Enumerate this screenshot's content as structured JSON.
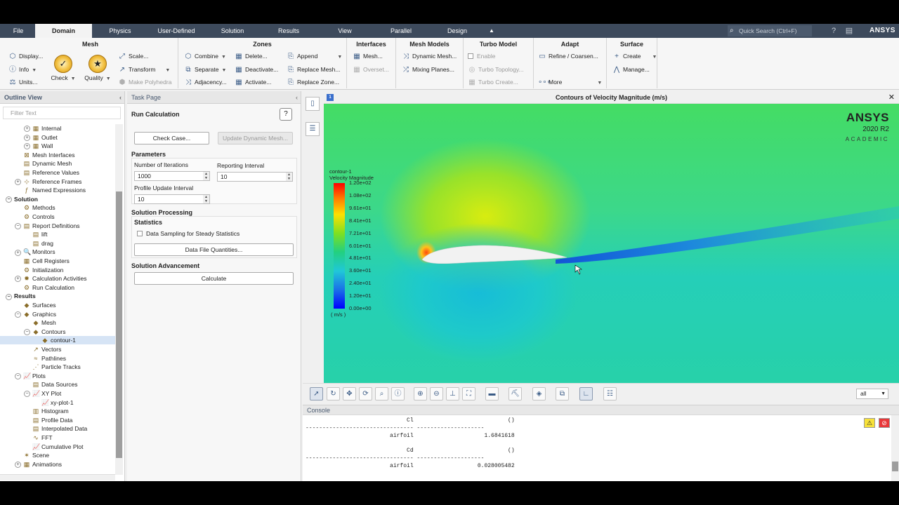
{
  "menubar": {
    "items": [
      "File",
      "Domain",
      "Physics",
      "User-Defined",
      "Solution",
      "Results",
      "View",
      "Parallel",
      "Design"
    ],
    "active": "Domain",
    "quick_search_placeholder": "Quick Search (Ctrl+F)",
    "brand": "ANSYS"
  },
  "ribbon": {
    "mesh": {
      "title": "Mesh",
      "display": "Display...",
      "info": "Info",
      "units": "Units...",
      "check": "Check",
      "quality": "Quality",
      "scale": "Scale...",
      "transform": "Transform",
      "make_polyhedra": "Make Polyhedra"
    },
    "zones": {
      "title": "Zones",
      "combine": "Combine",
      "separate": "Separate",
      "adjacency": "Adjacency...",
      "delete": "Delete...",
      "deactivate": "Deactivate...",
      "activate": "Activate...",
      "append": "Append",
      "replace_mesh": "Replace Mesh...",
      "replace_zone": "Replace Zone..."
    },
    "interfaces": {
      "title": "Interfaces",
      "mesh": "Mesh...",
      "overset": "Overset..."
    },
    "mesh_models": {
      "title": "Mesh Models",
      "dynamic_mesh": "Dynamic Mesh...",
      "mixing_planes": "Mixing Planes..."
    },
    "turbo_model": {
      "title": "Turbo Model",
      "enable": "Enable",
      "turbo_topology": "Turbo Topology...",
      "turbo_create": "Turbo Create..."
    },
    "adapt": {
      "title": "Adapt",
      "refine_coarsen": "Refine / Coarsen...",
      "more": "More"
    },
    "surface": {
      "title": "Surface",
      "create": "Create",
      "manage": "Manage..."
    }
  },
  "outline": {
    "header": "Outline View",
    "filter_placeholder": "Filter Text",
    "rows": [
      {
        "label": "Internal",
        "indent": 2,
        "exp": "+",
        "icon": "▦"
      },
      {
        "label": "Outlet",
        "indent": 2,
        "exp": "+",
        "icon": "▦"
      },
      {
        "label": "Wall",
        "indent": 2,
        "exp": "+",
        "icon": "▦"
      },
      {
        "label": "Mesh Interfaces",
        "indent": 1,
        "exp": "",
        "icon": "⊠"
      },
      {
        "label": "Dynamic Mesh",
        "indent": 1,
        "exp": "",
        "icon": "▤"
      },
      {
        "label": "Reference Values",
        "indent": 1,
        "exp": "",
        "icon": "▤"
      },
      {
        "label": "Reference Frames",
        "indent": 1,
        "exp": "+",
        "icon": "⊹"
      },
      {
        "label": "Named Expressions",
        "indent": 1,
        "exp": "",
        "icon": "ƒ"
      },
      {
        "label": "Solution",
        "indent": 0,
        "exp": "−",
        "icon": "",
        "section": true
      },
      {
        "label": "Methods",
        "indent": 1,
        "exp": "",
        "icon": "⚙"
      },
      {
        "label": "Controls",
        "indent": 1,
        "exp": "",
        "icon": "⚙"
      },
      {
        "label": "Report Definitions",
        "indent": 1,
        "exp": "−",
        "icon": "▤"
      },
      {
        "label": "lift",
        "indent": 2,
        "exp": "",
        "icon": "▤"
      },
      {
        "label": "drag",
        "indent": 2,
        "exp": "",
        "icon": "▤"
      },
      {
        "label": "Monitors",
        "indent": 1,
        "exp": "+",
        "icon": "🔍"
      },
      {
        "label": "Cell Registers",
        "indent": 1,
        "exp": "",
        "icon": "▦"
      },
      {
        "label": "Initialization",
        "indent": 1,
        "exp": "",
        "icon": "⚙"
      },
      {
        "label": "Calculation Activities",
        "indent": 1,
        "exp": "+",
        "icon": "✹"
      },
      {
        "label": "Run Calculation",
        "indent": 1,
        "exp": "",
        "icon": "⚙"
      },
      {
        "label": "Results",
        "indent": 0,
        "exp": "−",
        "icon": "",
        "section": true
      },
      {
        "label": "Surfaces",
        "indent": 1,
        "exp": "",
        "icon": "◆"
      },
      {
        "label": "Graphics",
        "indent": 1,
        "exp": "−",
        "icon": "◆"
      },
      {
        "label": "Mesh",
        "indent": 2,
        "exp": "",
        "icon": "◆"
      },
      {
        "label": "Contours",
        "indent": 2,
        "exp": "−",
        "icon": "◆"
      },
      {
        "label": "contour-1",
        "indent": 3,
        "exp": "",
        "icon": "◆",
        "selected": true
      },
      {
        "label": "Vectors",
        "indent": 2,
        "exp": "",
        "icon": "↗"
      },
      {
        "label": "Pathlines",
        "indent": 2,
        "exp": "",
        "icon": "≈"
      },
      {
        "label": "Particle Tracks",
        "indent": 2,
        "exp": "",
        "icon": "⋰"
      },
      {
        "label": "Plots",
        "indent": 1,
        "exp": "−",
        "icon": "📈"
      },
      {
        "label": "Data Sources",
        "indent": 2,
        "exp": "",
        "icon": "▤"
      },
      {
        "label": "XY Plot",
        "indent": 2,
        "exp": "−",
        "icon": "📈"
      },
      {
        "label": "xy-plot-1",
        "indent": 3,
        "exp": "",
        "icon": "📈"
      },
      {
        "label": "Histogram",
        "indent": 2,
        "exp": "",
        "icon": "▥"
      },
      {
        "label": "Profile Data",
        "indent": 2,
        "exp": "",
        "icon": "▤"
      },
      {
        "label": "Interpolated Data",
        "indent": 2,
        "exp": "",
        "icon": "▤"
      },
      {
        "label": "FFT",
        "indent": 2,
        "exp": "",
        "icon": "∿"
      },
      {
        "label": "Cumulative Plot",
        "indent": 2,
        "exp": "",
        "icon": "📈"
      },
      {
        "label": "Scene",
        "indent": 1,
        "exp": "",
        "icon": "✶"
      },
      {
        "label": "Animations",
        "indent": 1,
        "exp": "+",
        "icon": "▦"
      }
    ]
  },
  "task": {
    "header": "Task Page",
    "title": "Run Calculation",
    "check_case": "Check Case...",
    "update_dynamic_mesh": "Update Dynamic Mesh...",
    "parameters": "Parameters",
    "num_iterations_label": "Number of Iterations",
    "num_iterations": "1000",
    "reporting_interval_label": "Reporting Interval",
    "reporting_interval": "10",
    "profile_update_label": "Profile Update Interval",
    "profile_update": "10",
    "solution_processing": "Solution Processing",
    "statistics": "Statistics",
    "data_sampling": "Data Sampling for Steady Statistics",
    "data_file_quantities": "Data File Quantities...",
    "solution_advancement": "Solution Advancement",
    "calculate": "Calculate"
  },
  "graphics": {
    "title": "Contours of Velocity Magnitude (m/s)",
    "brand": "ANSYS",
    "version": "2020 R2",
    "edition": "ACADEMIC",
    "legend_name": "contour-1",
    "legend_var": "Velocity Magnitude",
    "legend_unit": "( m/s )",
    "legend_ticks": [
      "1.20e+02",
      "1.08e+02",
      "9.61e+01",
      "8.41e+01",
      "7.21e+01",
      "6.01e+01",
      "4.81e+01",
      "3.60e+01",
      "2.40e+01",
      "1.20e+01",
      "0.00e+00"
    ],
    "colors": {
      "freestream": "#3ad680",
      "upper_high": "#c8e81c",
      "wake": "#1565d8",
      "lower": "#1ec9c0",
      "stagnation": "#ff6a10"
    },
    "view_select": "all"
  },
  "console": {
    "header": "Console",
    "lines": [
      "                              Cl                            ()",
      "-------------------------------- --------------------",
      "                         airfoil                     1.6841618",
      "",
      "                              Cd                            ()",
      "-------------------------------- --------------------",
      "                         airfoil                   0.028005482"
    ]
  }
}
